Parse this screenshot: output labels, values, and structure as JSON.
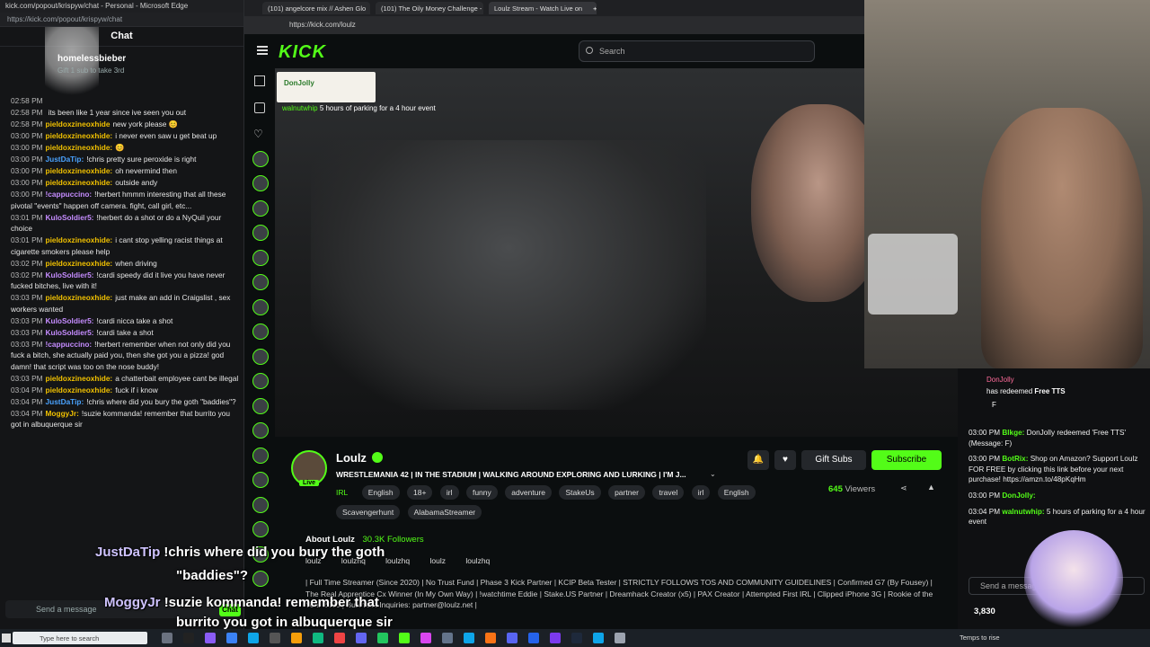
{
  "chat_window": {
    "title": "kick.com/popout/krispyw/chat - Personal - Microsoft Edge",
    "url": "https://kick.com/popout/krispyw/chat",
    "header": "Chat",
    "pinned_user": "homelessbieber",
    "pinned_text": "Gift 1 sub to take 3rd",
    "input_placeholder": "Send a message",
    "send_label": "Chat",
    "messages": [
      {
        "time": "02:58 PM",
        "name": "",
        "text": "",
        "color": "#ffffff"
      },
      {
        "time": "02:58 PM",
        "name": "",
        "text": "its been like 1 year since ive seen you out",
        "color": "#ffffff"
      },
      {
        "time": "02:58 PM",
        "name": "pieldoxzineoxhide",
        "text": "new york please 😊",
        "color": "#f0c000"
      },
      {
        "time": "03:00 PM",
        "name": "pieldoxzineoxhide:",
        "text": "i never even saw u get beat up",
        "color": "#f0c000"
      },
      {
        "time": "03:00 PM",
        "name": "pieldoxzineoxhide:",
        "text": "😊",
        "color": "#f0c000"
      },
      {
        "time": "03:00 PM",
        "name": "JustDaTip:",
        "text": "!chris pretty sure peroxide is right",
        "color": "#4aa3ff"
      },
      {
        "time": "03:00 PM",
        "name": "pieldoxzineoxhide:",
        "text": "oh nevermind then",
        "color": "#f0c000"
      },
      {
        "time": "03:00 PM",
        "name": "pieldoxzineoxhide:",
        "text": "outside andy",
        "color": "#f0c000"
      },
      {
        "time": "03:00 PM",
        "name": "!cappuccino:",
        "text": "!herbert hmmm interesting that all these pivotal \"events\" happen off camera. fight, call girl, etc...",
        "color": "#c58cff"
      },
      {
        "time": "03:01 PM",
        "name": "KuloSoldier5:",
        "text": "!herbert do a shot or do a NyQuil your choice",
        "color": "#c58cff"
      },
      {
        "time": "03:01 PM",
        "name": "pieldoxzineoxhide:",
        "text": "i cant stop yelling racist things at cigarette smokers please help",
        "color": "#f0c000"
      },
      {
        "time": "03:02 PM",
        "name": "pieldoxzineoxhide:",
        "text": "when driving",
        "color": "#f0c000"
      },
      {
        "time": "03:02 PM",
        "name": "KuloSoldier5:",
        "text": "!cardi speedy did it live you have never fucked bitches, live with it!",
        "color": "#c58cff"
      },
      {
        "time": "03:03 PM",
        "name": "pieldoxzineoxhide:",
        "text": "just make an add in Craigslist , sex workers wanted",
        "color": "#f0c000"
      },
      {
        "time": "03:03 PM",
        "name": "KuloSoldier5:",
        "text": "!cardi nicca take a shot",
        "color": "#c58cff"
      },
      {
        "time": "03:03 PM",
        "name": "KuloSoldier5:",
        "text": "!cardi take a shot",
        "color": "#c58cff"
      },
      {
        "time": "03:03 PM",
        "name": "!cappuccino:",
        "text": "!herbert remember when not only did you fuck a bitch, she actually paid you, then she got you a pizza! god damn! that script was too on the nose buddy!",
        "color": "#c58cff"
      },
      {
        "time": "03:03 PM",
        "name": "pieldoxzineoxhide:",
        "text": "a chatterbait employee cant be illegal",
        "color": "#f0c000"
      },
      {
        "time": "03:04 PM",
        "name": "pieldoxzineoxhide:",
        "text": "fuck if i know",
        "color": "#f0c000"
      },
      {
        "time": "03:04 PM",
        "name": "JustDaTip:",
        "text": "!chris where did you bury the goth \"baddies\"?",
        "color": "#4aa3ff"
      },
      {
        "time": "03:04 PM",
        "name": "MoggyJr:",
        "text": "!suzie kommanda! remember that burrito you got in albuquerque sir",
        "color": "#f0c000"
      }
    ]
  },
  "browser": {
    "tabs": [
      "(101) angelcore mix // Ashen Glo",
      "(101) The Oily Money Challenge -",
      "Loulz Stream - Watch Live on"
    ],
    "url": "https://kick.com/loulz"
  },
  "kick": {
    "logo": "KICK",
    "search_placeholder": "Search",
    "alert_name": "DonJolly",
    "overlay_note_user": "walnutwhip",
    "overlay_note": "5 hours of parking for a 4 hour event"
  },
  "stream": {
    "channel": "Loulz",
    "live_label": "Live",
    "title": "WRESTLEMANIA 42 | IN THE STADIUM | WALKING AROUND EXPLORING AND LURKING | I'M J...",
    "category": "IRL",
    "tags": [
      "English",
      "18+",
      "irl",
      "funny",
      "adventure",
      "StakeUs",
      "partner",
      "travel",
      "irl",
      "English",
      "Scavengerhunt",
      "AlabamaStreamer"
    ],
    "gift_subs": "Gift Subs",
    "subscribe": "Subscribe",
    "viewers_count": "645",
    "viewers_label": "Viewers",
    "about_title": "About Loulz",
    "followers": "30.3K Followers",
    "socials": [
      "loulz",
      "loulzhq",
      "loulzhq",
      "loulz",
      "loulzhq"
    ],
    "bio": "| Full Time Streamer (Since 2020) | No Trust Fund | Phase 3 Kick Partner | KCIP Beta Tester | STRICTLY FOLLOWS TOS AND COMMUNITY GUIDELINES | Confirmed G7 (By Fousey) | The Real Apprentice Cx Winner (In My Own Way) | !watchtime Eddie | Stake.US Partner | Dreamhack Creator (x5) | PAX Creator | Attempted First IRL | Clipped iPhone 3G | Rookie of the Year 2020 | Business Inquiries: partner@loulz.net |"
  },
  "overlay_chat": {
    "redeem_user": "DonJolly",
    "redeem_text": "has redeemed",
    "redeem_item": "Free TTS",
    "redeem_msg": "F",
    "messages": [
      {
        "time": "03:00 PM",
        "name": "Blkge:",
        "text": "DonJolly redeemed 'Free TTS' (Message: F)"
      },
      {
        "time": "03:00 PM",
        "name": "BotRix:",
        "text": "Shop on Amazon? Support Loulz FOR FREE by clicking this link before your next purchase! https://amzn.to/48pKqHm"
      },
      {
        "time": "03:00 PM",
        "name": "DonJolly:",
        "text": ""
      },
      {
        "time": "03:04 PM",
        "name": "walnutwhip:",
        "text": "5 hours of parking for a 4 hour event"
      }
    ],
    "input_placeholder": "Send a message",
    "count": "3,830"
  },
  "overlay_text": {
    "line1_user": "JustDaTip",
    "line1": "!chris where did you bury the goth",
    "line2": "\"baddies\"?",
    "line3_user": "MoggyJr",
    "line3": "!suzie kommanda! remember that",
    "line4": "burrito you got in albuquerque sir"
  },
  "taskbar": {
    "search_placeholder": "Type here to search",
    "status": "Temps to rise"
  },
  "colors": {
    "accent": "#53fc18",
    "bg": "#0b0e0f"
  }
}
